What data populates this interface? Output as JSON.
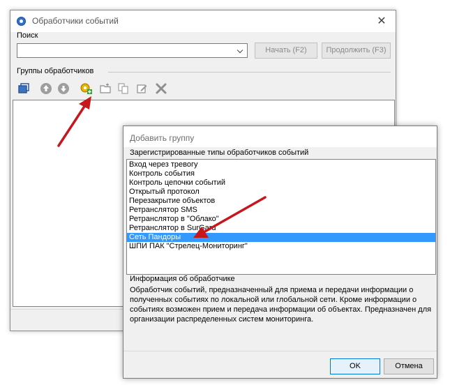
{
  "main_window": {
    "title": "Обработчики событий",
    "close_glyph": "✕",
    "search": {
      "label": "Поиск",
      "value": "",
      "placeholder": ""
    },
    "buttons": {
      "start": "Начать (F2)",
      "continue": "Продолжить (F3)"
    },
    "groups_label": "Группы обработчиков",
    "toolbar_icons": [
      "copy-window-icon",
      "move-up-icon",
      "move-down-icon",
      "add-group-icon",
      "new-folder-icon",
      "copy-icon",
      "edit-icon",
      "delete-icon"
    ]
  },
  "dialog": {
    "title": "Добавить группу",
    "types_label": "Зарегистрированные типы обработчиков событий",
    "types": [
      "Вход через тревогу",
      "Контроль события",
      "Контроль цепочки событий",
      "Открытый протокол",
      "Перезакрытие объектов",
      "Ретранслятор SMS",
      "Ретранслятор в \"Облако\"",
      "Ретранслятор в SurGard",
      "Сеть Пандоры",
      "ШПИ ПАК \"Стрелец-Мониторинг\""
    ],
    "selected_index": 8,
    "info_label": "Информация об обработчике",
    "info_text": "Обработчик событий, предназначенный для приема и передачи информации о полученных событиях по локальной или глобальной сети. Кроме информации о событиях возможен прием и передача информации об объектах. Предназначен для организации распределенных систем мониторинга.",
    "ok": "OK",
    "cancel": "Отмена"
  },
  "colors": {
    "selection": "#3399ff",
    "annotation_arrow": "#c8161d",
    "window_bg": "#f0f0f0"
  }
}
